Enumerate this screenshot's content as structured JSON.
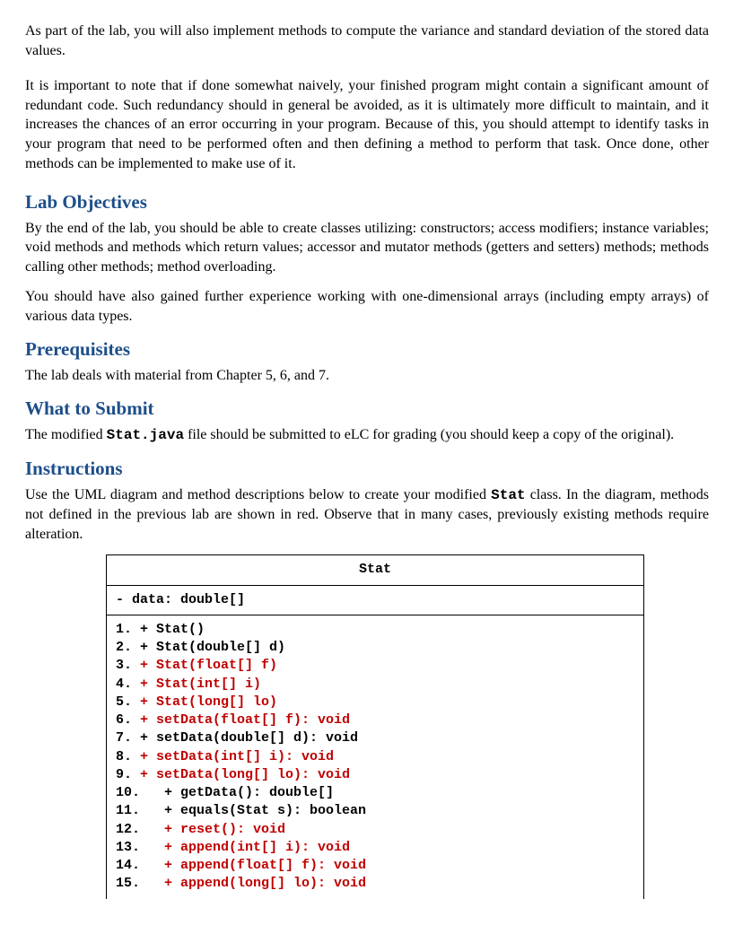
{
  "intro_p1": "As part of the lab, you will also implement methods to compute the variance and standard deviation of the stored data values.",
  "intro_p2": "It is important to note that if done somewhat naively, your finished program might contain a significant amount of redundant code. Such redundancy should in general be avoided, as it is ultimately more difficult to maintain, and it increases the chances of an error occurring in your program. Because of this, you should attempt to identify tasks in your program that need to be performed often and then defining a method to perform that task. Once done, other methods can be implemented to make use of it.",
  "sections": {
    "objectives": {
      "title": "Lab Objectives",
      "p1": "By the end of the lab, you should be able to create classes utilizing:  constructors; access modifiers; instance variables; void methods and methods which return values; accessor and mutator methods (getters and setters) methods; methods calling other methods; method overloading.",
      "p2": "You should have also gained further experience working with one-dimensional arrays (including empty arrays) of various data types."
    },
    "prereq": {
      "title": "Prerequisites",
      "p1": "The lab deals with material from Chapter 5, 6, and 7."
    },
    "submit": {
      "title": "What to Submit",
      "p1_a": "The modified ",
      "p1_code": "Stat.java",
      "p1_b": " file should be submitted to eLC for grading (you should keep a copy of the original)."
    },
    "instructions": {
      "title": "Instructions",
      "p1_a": "Use the UML diagram and method descriptions below to create your modified ",
      "p1_code": "Stat",
      "p1_b": " class. In the diagram, methods not defined in the previous lab are shown in red. Observe that in many cases, previously existing methods require alteration."
    }
  },
  "uml": {
    "class_name": "Stat",
    "attribute": "- data: double[]",
    "methods": [
      {
        "n": "1.",
        "sig": "+ Stat()",
        "red": false
      },
      {
        "n": "2.",
        "sig": "+ Stat(double[] d)",
        "red": false
      },
      {
        "n": "3.",
        "sig": "+ Stat(float[] f)",
        "red": true
      },
      {
        "n": "4.",
        "sig": "+ Stat(int[] i)",
        "red": true
      },
      {
        "n": "5.",
        "sig": "+ Stat(long[] lo)",
        "red": true
      },
      {
        "n": "6.",
        "sig": "+ setData(float[] f): void",
        "red": true
      },
      {
        "n": "7.",
        "sig": "+ setData(double[] d): void",
        "red": false
      },
      {
        "n": "8.",
        "sig": "+ setData(int[] i): void",
        "red": true
      },
      {
        "n": "9.",
        "sig": "+ setData(long[] lo): void",
        "red": true
      },
      {
        "n": "10.",
        "sig": "  + getData(): double[]",
        "red": false
      },
      {
        "n": "11.",
        "sig": "  + equals(Stat s): boolean",
        "red": false
      },
      {
        "n": "12.",
        "sig": "  + reset(): void",
        "red": true
      },
      {
        "n": "13.",
        "sig": "  + append(int[] i): void",
        "red": true
      },
      {
        "n": "14.",
        "sig": "  + append(float[] f): void",
        "red": true
      },
      {
        "n": "15.",
        "sig": "  + append(long[] lo): void",
        "red": true
      }
    ]
  }
}
